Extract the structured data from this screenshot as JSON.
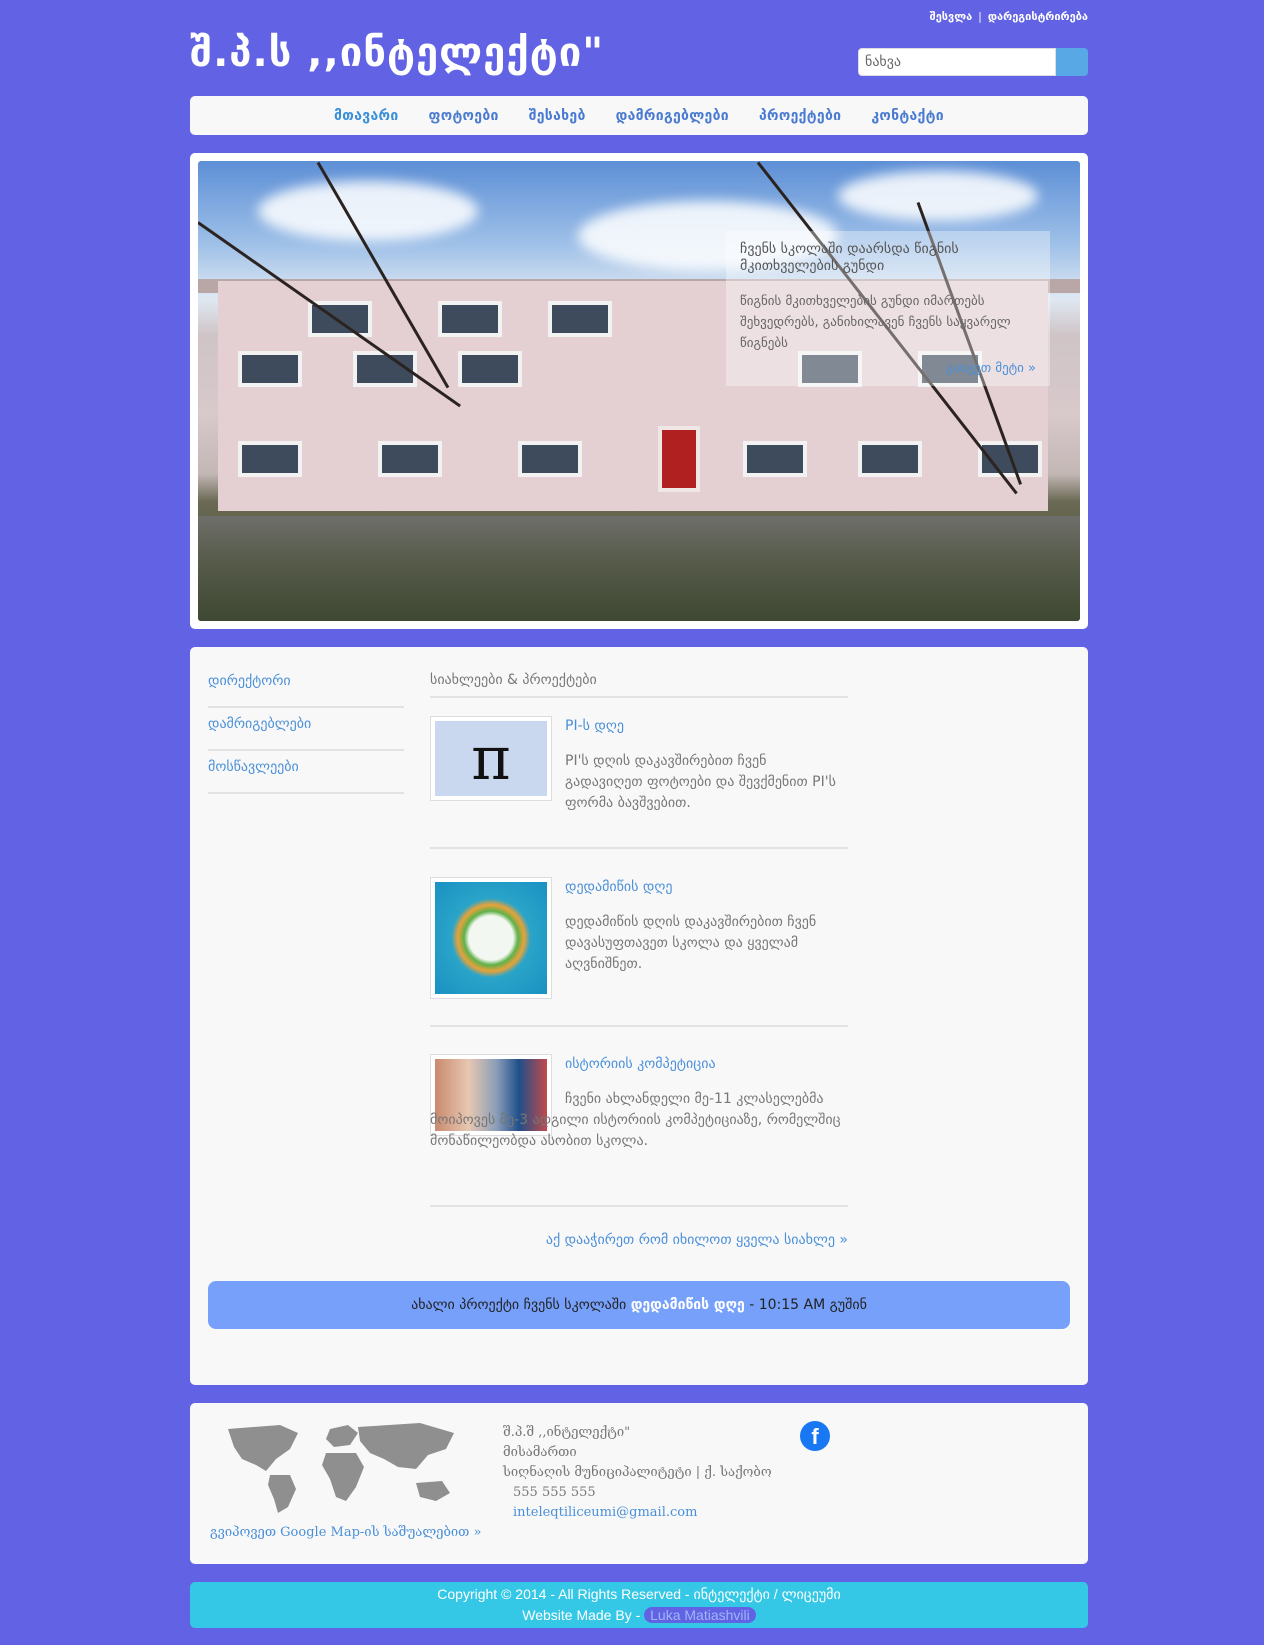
{
  "header": {
    "logo": "შ.პ.ს ,,ინტელექტი\"",
    "login": "შესვლა",
    "register": "დარეგისტრირება",
    "search_placeholder": "ნახვა"
  },
  "nav": {
    "items": [
      {
        "label": "მთავარი"
      },
      {
        "label": "ფოტოები"
      },
      {
        "label": "შესახებ"
      },
      {
        "label": "დამრიგებლები"
      },
      {
        "label": "პროექტები"
      },
      {
        "label": "კონტაქტი"
      }
    ]
  },
  "hero": {
    "title": "ჩვენს სკოლაში დაარსდა წიგნის მკითხველების გუნდი",
    "text": "წიგნის მკითხველების გუნდი იმართებს შეხვედრებს, განიხილავენ ჩვენს საყვარელ წიგნებს",
    "more": "გაიგეთ მეტი »"
  },
  "side_menu": {
    "items": [
      {
        "label": "დირექტორი"
      },
      {
        "label": "დამრიგებლები"
      },
      {
        "label": "მოსწავლეები"
      }
    ]
  },
  "news": {
    "heading": "სიახლეები & პროექტები",
    "items": [
      {
        "title": "PI-ს დღე",
        "text": "PI'ს დღის დაკავშირებით ჩვენ გადავიღეთ ფოტოები და შევქმენით PI'ს ფორმა ბავშვებით."
      },
      {
        "title": "დედამიწის დღე",
        "text": "დედამიწის დღის დაკავშირებით ჩვენ დავასუფთავეთ სკოლა და ყველამ აღვნიშნეთ."
      },
      {
        "title": "ისტორიის კომპეტიცია",
        "text": "ჩვენი ახლანდელი მე-11 კლასელებმა მოიპოვეს მე-3 ადგილი ისტორიის კომპეტიციაზე, რომელშიც მონაწილეობდა ასობით სკოლა."
      }
    ],
    "all_link": "აქ დააჭირეთ რომ იხილოთ ყველა სიახლე »"
  },
  "ticker": {
    "prefix": "ახალი პროექტი ჩვენს სკოლაში",
    "link": "დედამიწის დღე",
    "suffix": "- 10:15 AM გუშინ"
  },
  "footer": {
    "map_link": "გვიპოვეთ Google Map-ის საშუალებით »",
    "org": "შ.პ.შ ,,ინტელექტი\"",
    "address_label": "მისამართი",
    "address": "სიღნაღის მუნიციპალიტეტი | ქ. საქობო",
    "phone": "555 555 555",
    "email": "inteleqtiliceumi@gmail.com",
    "fb_icon": "facebook-icon"
  },
  "copyright": {
    "line1": "Copyright © 2014 - All Rights Reserved - ინტელექტი / ლიცეუმი",
    "made_by": "Website Made By -",
    "author": "Luka Matiashvili"
  },
  "colors": {
    "background": "#6163e4",
    "accent": "#4a90d9",
    "ticker": "#76a0fa",
    "copyright_bar": "#35c8e6"
  }
}
